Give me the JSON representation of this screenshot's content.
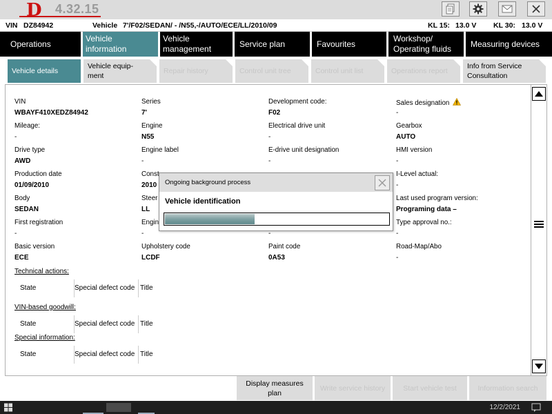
{
  "titlebar": {
    "logo_letter": "D",
    "version": "4.32.15",
    "icons": [
      "document-icon",
      "gear-icon",
      "mail-icon",
      "close-icon"
    ]
  },
  "infobar": {
    "vin_label": "VIN",
    "vin_value": "DZ84942",
    "vehicle_label": "Vehicle",
    "vehicle_value": "7'/F02/SEDAN/ - /N55,-/AUTO/ECE/LL/2010/09",
    "kl15_label": "KL 15:",
    "kl15_value": "13.0 V",
    "kl30_label": "KL 30:",
    "kl30_value": "13.0 V"
  },
  "main_tabs": [
    {
      "label": "Operations"
    },
    {
      "label": "Vehicle information"
    },
    {
      "label": "Vehicle management"
    },
    {
      "label": "Service plan"
    },
    {
      "label": "Favourites"
    },
    {
      "label": "Workshop/ Operating fluids"
    },
    {
      "label": "Measuring devices"
    }
  ],
  "sub_tabs": [
    {
      "label": "Vehicle details"
    },
    {
      "label": "Vehicle equip- ment"
    },
    {
      "label": "Repair history"
    },
    {
      "label": "Control unit tree"
    },
    {
      "label": "Control unit list"
    },
    {
      "label": "Operations report"
    },
    {
      "label": "Info from Service Consultation"
    }
  ],
  "details": {
    "vin": {
      "label": "VIN",
      "value": "WBAYF410XEDZ84942"
    },
    "series": {
      "label": "Series",
      "value": "7'"
    },
    "development_code": {
      "label": "Development code:",
      "value": "F02"
    },
    "sales_designation": {
      "label": "Sales designation",
      "value": "-"
    },
    "mileage": {
      "label": "Mileage:",
      "value": "-"
    },
    "engine": {
      "label": "Engine",
      "value": "N55"
    },
    "electrical_drive_unit": {
      "label": "Electrical drive unit",
      "value": "-"
    },
    "gearbox": {
      "label": "Gearbox",
      "value": "AUTO"
    },
    "drive_type": {
      "label": "Drive type",
      "value": "AWD"
    },
    "engine_label": {
      "label": "Engine label",
      "value": "-"
    },
    "e_drive_unit": {
      "label": "E-drive unit designation",
      "value": "-"
    },
    "hmi_version": {
      "label": "HMI version",
      "value": "-"
    },
    "production_date": {
      "label": "Production date",
      "value": "01/09/2010"
    },
    "construction": {
      "label": "Const",
      "value": "2010 ."
    },
    "i_level_actual": {
      "label": "I-Level actual:",
      "value": "-"
    },
    "body": {
      "label": "Body",
      "value": "SEDAN"
    },
    "steering": {
      "label": "Steer",
      "value": "LL"
    },
    "last_program_version": {
      "label": "Last used program version:",
      "value": "Programing data –"
    },
    "first_registration": {
      "label": "First registration",
      "value": "-"
    },
    "engine2": {
      "label": "Engin",
      "value": "-"
    },
    "col3_row6": {
      "label": "",
      "value": "-"
    },
    "type_approval": {
      "label": "Type approval no.:",
      "value": "-"
    },
    "basic_version": {
      "label": "Basic version",
      "value": "ECE"
    },
    "upholstery_code": {
      "label": "Upholstery code",
      "value": "LCDF"
    },
    "paint_code": {
      "label": "Paint code",
      "value": "0A53"
    },
    "road_map": {
      "label": "Road-Map/Abo",
      "value": "-"
    }
  },
  "sections": [
    {
      "title": "Technical actions:",
      "columns": [
        "State",
        "Special defect code",
        "Title"
      ]
    },
    {
      "title": "VIN-based goodwill:",
      "columns": [
        "State",
        "Special defect code",
        "Title"
      ]
    },
    {
      "title": "Special information:",
      "columns": [
        "State",
        "Special defect code",
        "Title"
      ]
    }
  ],
  "dialog": {
    "title": "Ongoing background process",
    "message": "Vehicle identification",
    "progress": 0.4
  },
  "bottom_buttons": [
    {
      "label": "Display measures plan"
    },
    {
      "label": "Write service history"
    },
    {
      "label": "Start vehicle test"
    },
    {
      "label": "Information search"
    }
  ],
  "taskbar": {
    "clock": "12/2/2021"
  },
  "colors": {
    "accent_teal": "#4a8a92",
    "tab_bar": "#000000",
    "inactive_tab": "#dcdcdc",
    "warning": "#f0b400",
    "logo_red": "#cc1111"
  }
}
